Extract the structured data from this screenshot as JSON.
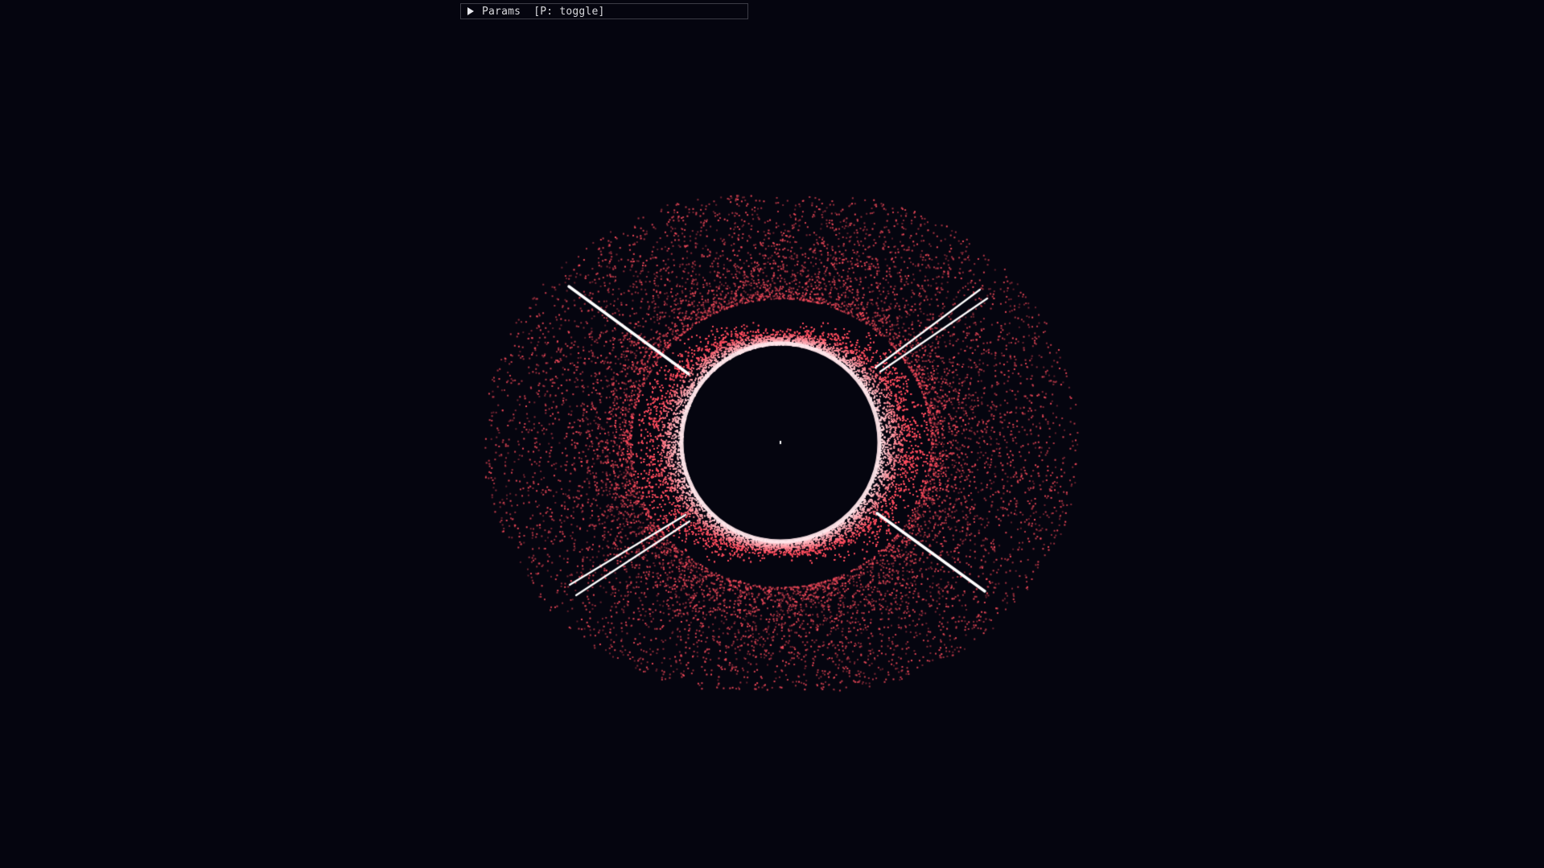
{
  "app": {
    "background_color": "#05050f"
  },
  "params_panel": {
    "toggle_icon": "play-triangle-icon",
    "label": "Params  [P: toggle]",
    "collapsed": true
  },
  "visualization": {
    "particle_color": "#ff4d5e",
    "glow_color": "#ffe6ea",
    "core_color": "#05050f",
    "jet_color": "#ffffff"
  }
}
